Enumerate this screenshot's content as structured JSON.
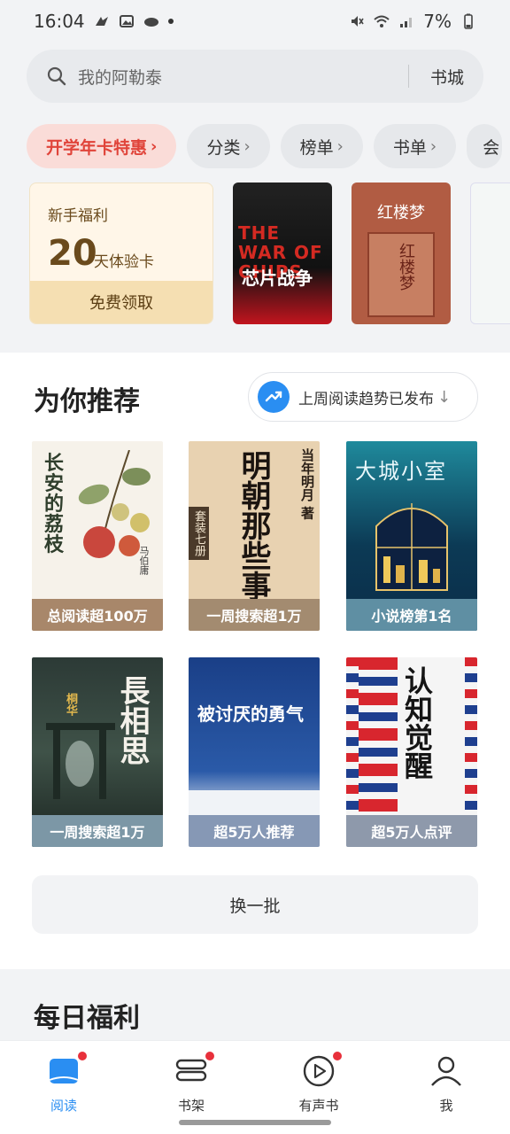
{
  "status": {
    "time": "16:04",
    "battery": "7%"
  },
  "search": {
    "placeholder": "我的阿勒泰",
    "store": "书城"
  },
  "pills": [
    {
      "label": "开学年卡特惠",
      "hot": true
    },
    {
      "label": "分类"
    },
    {
      "label": "榜单"
    },
    {
      "label": "书单"
    }
  ],
  "welfare": {
    "title": "新手福利",
    "number": "20",
    "unit": "天体验卡",
    "button": "免费领取"
  },
  "promo_books": [
    {
      "title": "芯片战争",
      "cover_text": "THE WAR OF CHIPS"
    },
    {
      "title": "红楼梦",
      "cover_text": "红楼梦"
    }
  ],
  "recommend": {
    "title": "为你推荐",
    "trend": "上周阅读趋势已发布",
    "trend_arrow": "↓",
    "books": [
      {
        "cover_title": "长安的荔枝",
        "author": "马伯庸",
        "caption": "总阅读超100万"
      },
      {
        "cover_title": "明朝那些事",
        "author": "当年明月 著",
        "badge": "套装七册",
        "caption": "一周搜索超1万"
      },
      {
        "cover_title": "大城小室",
        "caption": "小说榜第1名"
      },
      {
        "cover_title": "長相思",
        "author": "桐华",
        "caption": "一周搜索超1万"
      },
      {
        "cover_title": "被讨厌的勇气",
        "caption": "超5万人推荐"
      },
      {
        "cover_title": "认知觉醒",
        "caption": "超5万人点评"
      }
    ],
    "refresh": "换一批"
  },
  "daily": {
    "title": "每日福利"
  },
  "nav": [
    {
      "label": "阅读",
      "active": true,
      "dot": true
    },
    {
      "label": "书架",
      "dot": true
    },
    {
      "label": "有声书",
      "dot": true
    },
    {
      "label": "我",
      "dot": false
    }
  ],
  "colors": {
    "accent": "#2a8ef2",
    "hot": "#e0443a",
    "badge": "#e8303b"
  }
}
